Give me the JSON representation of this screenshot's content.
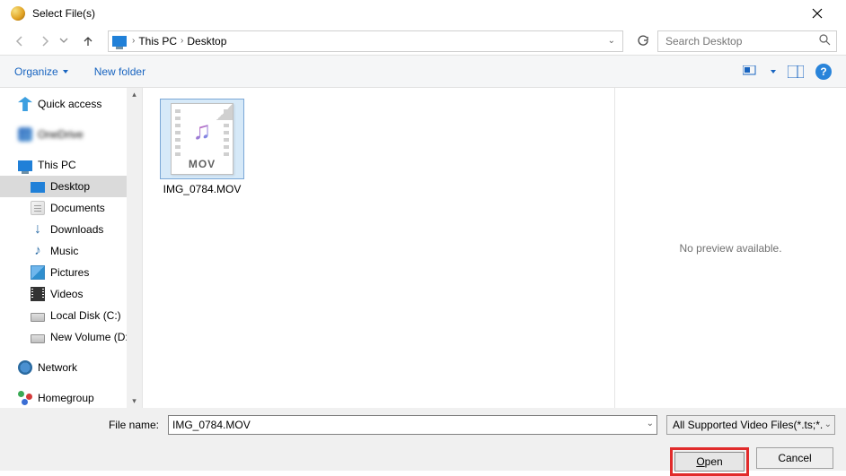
{
  "title": "Select File(s)",
  "breadcrumb": {
    "pc": "This PC",
    "desktop": "Desktop"
  },
  "search_placeholder": "Search Desktop",
  "toolbar": {
    "organize": "Organize",
    "new_folder": "New folder"
  },
  "tree": {
    "quick": "Quick access",
    "onedrive": "OneDrive",
    "this_pc": "This PC",
    "desktop": "Desktop",
    "documents": "Documents",
    "downloads": "Downloads",
    "music": "Music",
    "pictures": "Pictures",
    "videos": "Videos",
    "local_disk": "Local Disk (C:)",
    "new_volume": "New Volume (D:)",
    "network": "Network",
    "homegroup": "Homegroup"
  },
  "file": {
    "name": "IMG_0784.MOV",
    "ext": "MOV"
  },
  "preview_text": "No preview available.",
  "file_name_label": "File name:",
  "file_name_value": "IMG_0784.MOV",
  "filter_label": "All Supported Video Files(*.ts;*.",
  "open_btn_prefix": "O",
  "open_btn_rest": "pen",
  "cancel_btn": "Cancel"
}
